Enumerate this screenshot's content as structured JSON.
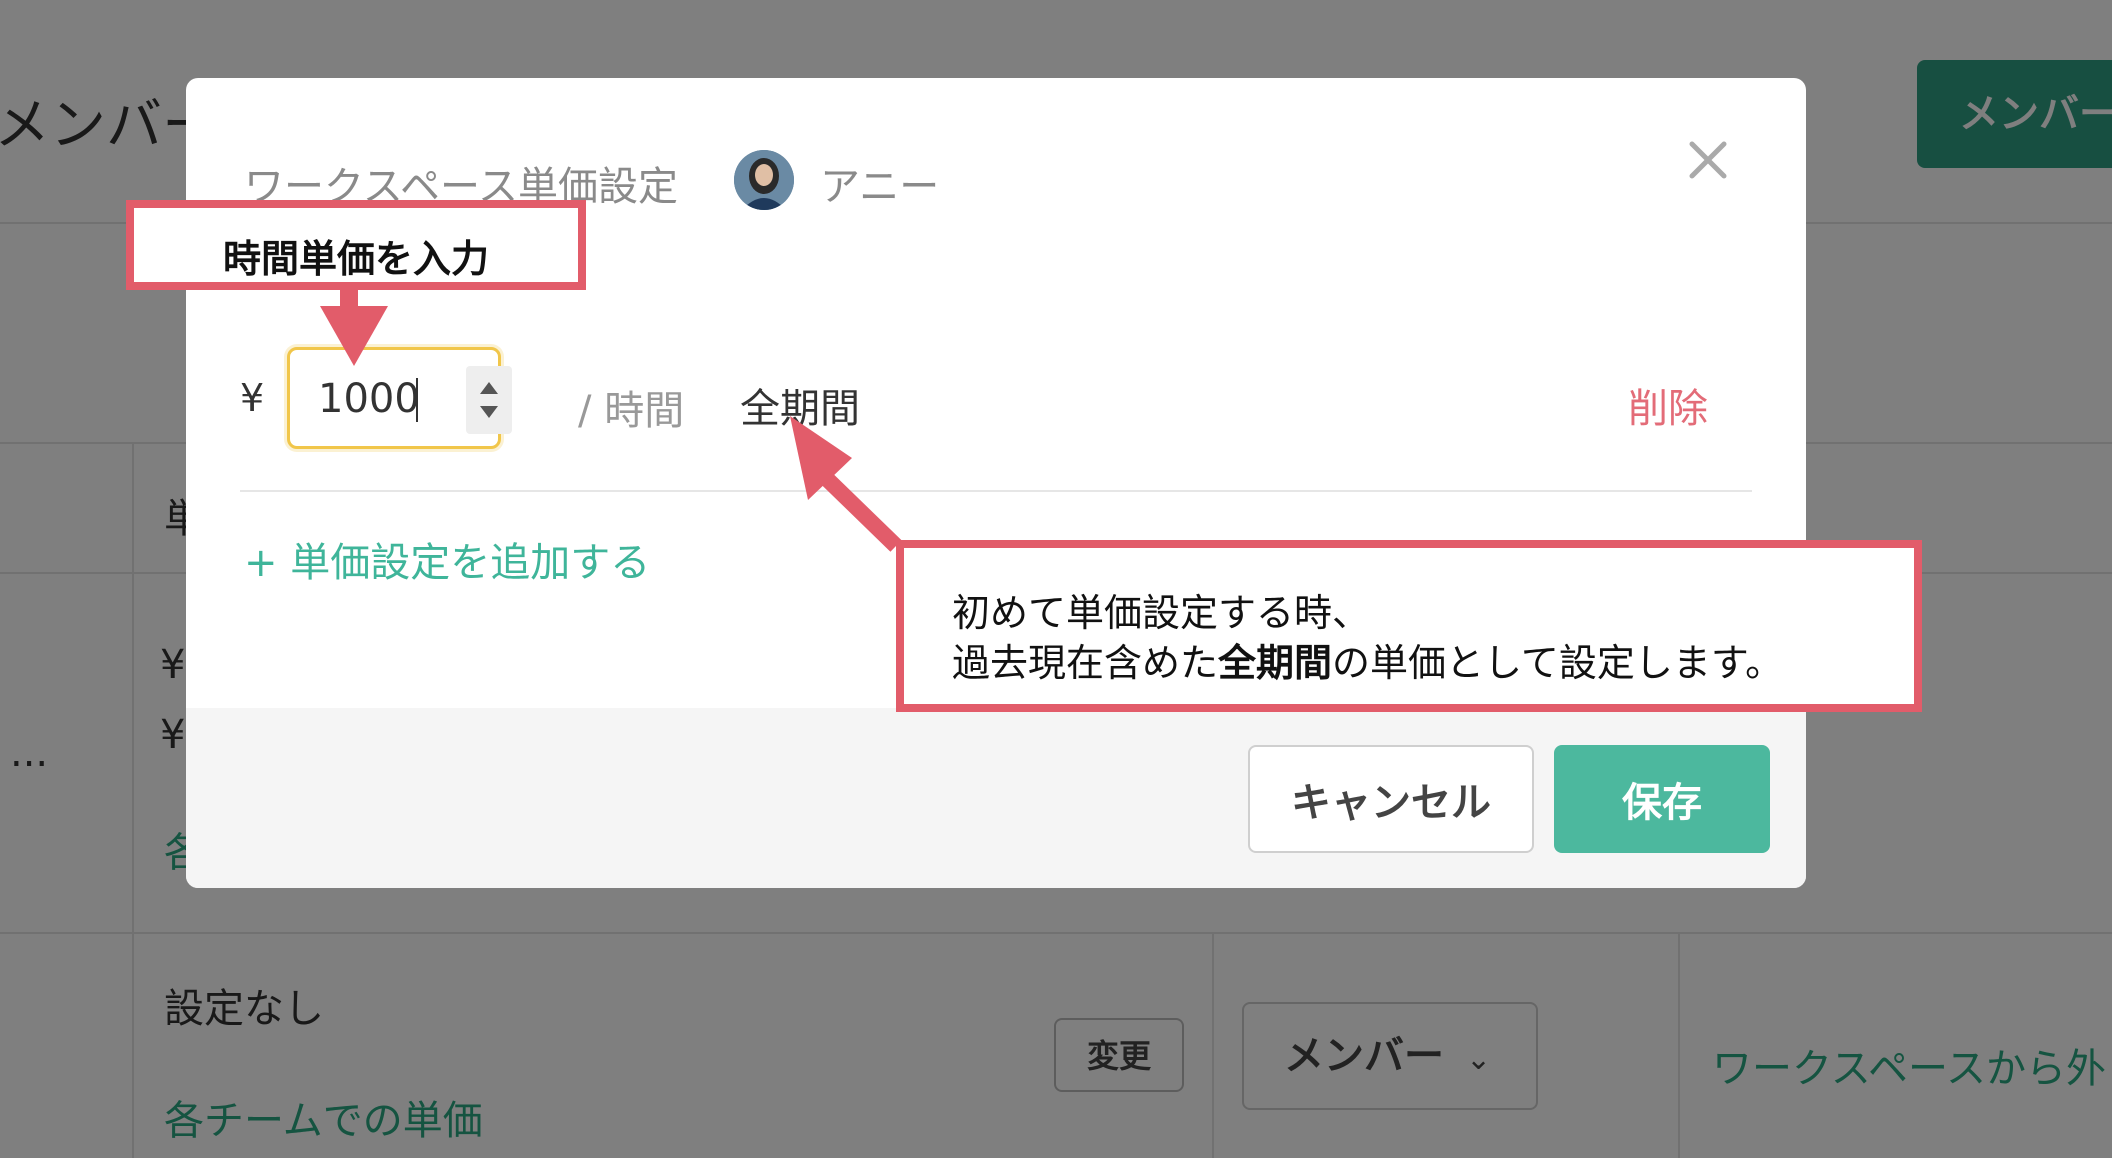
{
  "background": {
    "title": "メンバー管理",
    "member_button": "メンバー",
    "col_header": "単価",
    "row1": {
      "rate1": "¥",
      "rate2": "¥",
      "team_link": "各",
      "ellipsis": "..."
    },
    "row2": {
      "rate_status": "設定なし",
      "team_rate_link": "各チームでの単価",
      "change_button": "変更",
      "role": "メンバー",
      "remove_link": "ワークスペースから外"
    }
  },
  "modal": {
    "title": "ワークスペース単価設定",
    "user_name": "アニー",
    "currency_symbol": "¥",
    "rate_value": "1000",
    "per_hour": "/ 時間",
    "period": "全期間",
    "delete_label": "削除",
    "add_rate_label": "+  単価設定を追加する",
    "cancel_label": "キャンセル",
    "save_label": "保存"
  },
  "annotations": {
    "callout_input": "時間単価を入力",
    "callout_period_line1": "初めて単価設定する時、",
    "callout_period_line2_pre": "過去現在含めた",
    "callout_period_line2_bold": "全期間",
    "callout_period_line2_post": "の単価として設定します。"
  },
  "colors": {
    "accent": "#4cb89e",
    "link": "#3fb59a",
    "danger": "#e36c78",
    "annotation": "#e25c6a",
    "focus": "#f1c64a"
  }
}
